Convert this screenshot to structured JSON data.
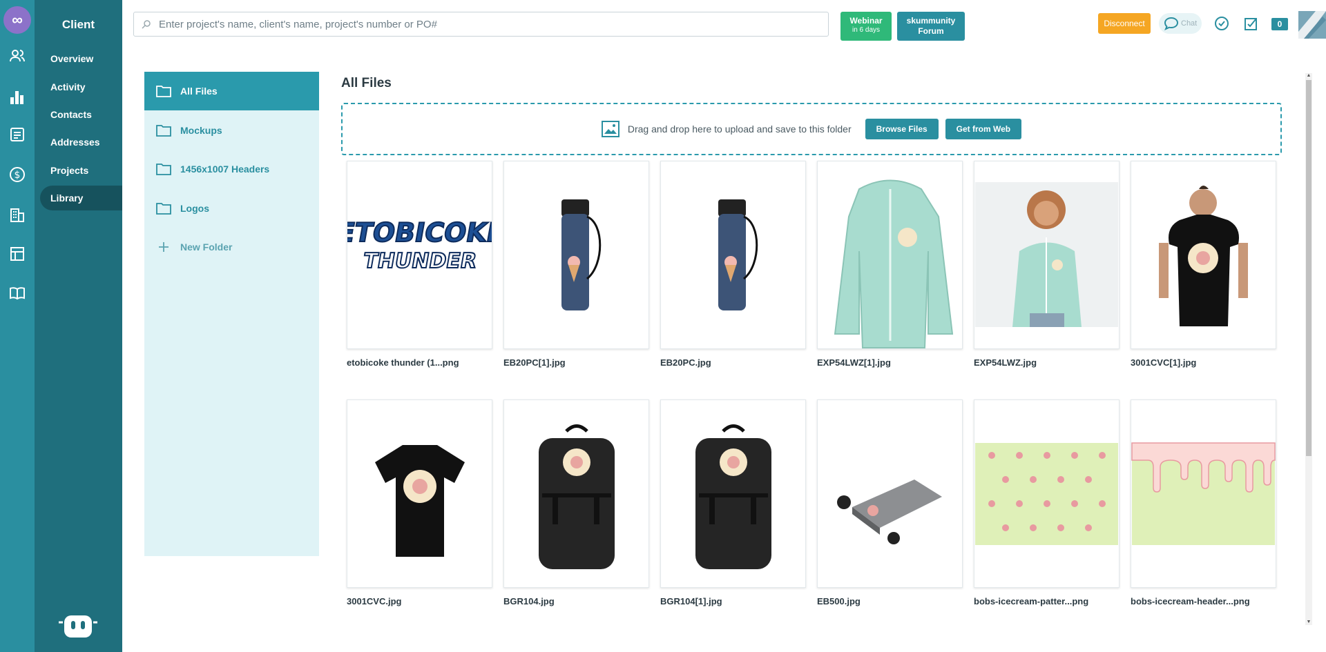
{
  "nav": {
    "section_title": "Client",
    "items": [
      {
        "label": "Overview"
      },
      {
        "label": "Activity"
      },
      {
        "label": "Contacts"
      },
      {
        "label": "Addresses"
      },
      {
        "label": "Projects"
      },
      {
        "label": "Library",
        "active": true
      }
    ],
    "rail_icons": [
      "users-icon",
      "bar-chart-icon",
      "document-icon",
      "dollar-icon",
      "building-icon",
      "table-icon",
      "book-icon"
    ]
  },
  "header": {
    "search_placeholder": "Enter project's name, client's name, project's number or PO#",
    "webinar_label": "Webinar",
    "webinar_sub": "in 6 days",
    "forum_line1": "skummunity",
    "forum_line2": "Forum",
    "disconnect_label": "Disconnect",
    "chat_label": "Chat",
    "badge_count": "0"
  },
  "folders": [
    {
      "label": "All Files",
      "active": true
    },
    {
      "label": "Mockups"
    },
    {
      "label": "1456x1007 Headers"
    },
    {
      "label": "Logos"
    }
  ],
  "new_folder_label": "New Folder",
  "main": {
    "title": "All Files",
    "drop_text": "Drag and drop here to upload and save to this folder",
    "browse_label": "Browse Files",
    "web_label": "Get from Web"
  },
  "files": [
    {
      "name": "etobicoke thunder (1...png",
      "kind": "logo"
    },
    {
      "name": "EB20PC[1].jpg",
      "kind": "bottle"
    },
    {
      "name": "EB20PC.jpg",
      "kind": "bottle"
    },
    {
      "name": "EXP54LWZ[1].jpg",
      "kind": "jacket"
    },
    {
      "name": "EXP54LWZ.jpg",
      "kind": "jacket-model"
    },
    {
      "name": "3001CVC[1].jpg",
      "kind": "tshirt-model"
    },
    {
      "name": "3001CVC.jpg",
      "kind": "tshirt"
    },
    {
      "name": "BGR104.jpg",
      "kind": "backpack"
    },
    {
      "name": "BGR104[1].jpg",
      "kind": "backpack"
    },
    {
      "name": "EB500.jpg",
      "kind": "earbuds"
    },
    {
      "name": "bobs-icecream-patter...png",
      "kind": "pattern"
    },
    {
      "name": "bobs-icecream-header...png",
      "kind": "header"
    }
  ],
  "logo_text": {
    "line1": "ETOBICOKE",
    "line2": "THUNDER"
  },
  "colors": {
    "rail": "#2a8fa0",
    "subnav": "#1f6f7d",
    "accent": "#2a9aac",
    "webinar": "#2fb979",
    "disconnect": "#f5a623",
    "mint": "#a8dccf"
  }
}
